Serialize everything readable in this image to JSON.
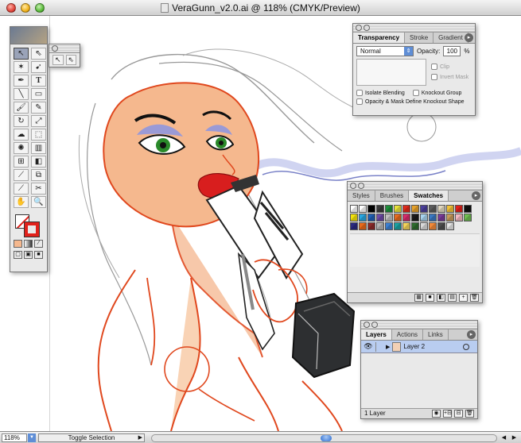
{
  "window": {
    "title": "VeraGunn_v2.0.ai @ 118% (CMYK/Preview)"
  },
  "transparency": {
    "tabs": [
      "Transparency",
      "Stroke",
      "Gradient"
    ],
    "blend_mode": "Normal",
    "opacity_label": "Opacity:",
    "opacity_value": "100",
    "opacity_unit": "%",
    "clip_label": "Clip",
    "invert_mask_label": "Invert Mask",
    "isolate_blending_label": "Isolate Blending",
    "knockout_group_label": "Knockout Group",
    "opacity_mask_label": "Opacity & Mask Define Knockout Shape"
  },
  "swatches": {
    "tabs": [
      "Styles",
      "Brushes",
      "Swatches"
    ],
    "colors": [
      "#ffffff",
      "#ffffff",
      "#000000",
      "#3a3a3a",
      "#1d8f3a",
      "#e8e23a",
      "#e02a1b",
      "#e6a12b",
      "#4b3f99",
      "#5b5b5b",
      "#e2d8c0",
      "#f2c237",
      "#e0211b",
      "#0f0f0f",
      "#f2e20d",
      "#2aa6e0",
      "#1f5fb5",
      "#6e4aa8",
      "#c0c0c0",
      "#e66b1e",
      "#d62a6b",
      "#1a1a1a",
      "#a8d3f0",
      "#3a78c2",
      "#7a3a9a",
      "#c89a5a",
      "#f5b8c0",
      "#6fbf50",
      "#2a2a80",
      "#e86a1c",
      "#8c2a2a",
      "#b5b5b5",
      "#3b7fd1",
      "#1ba0a0",
      "#f2d25a",
      "#2e6b2e",
      "#d9d9d9",
      "#f28a3a",
      "#4d4d4d",
      "#e6e6e6"
    ]
  },
  "layers": {
    "tabs": [
      "Layers",
      "Actions",
      "Links"
    ],
    "rows": [
      {
        "name": "Layer 2"
      }
    ],
    "count_label": "1 Layer"
  },
  "status": {
    "zoom": "118%",
    "mode": "Toggle Selection"
  },
  "icons": {
    "toolbox": [
      "selection-arrow-icon",
      "direct-selection-icon",
      "magic-wand-icon",
      "lasso-icon",
      "pen-icon",
      "type-icon",
      "line-icon",
      "rectangle-icon",
      "paintbrush-icon",
      "pencil-icon",
      "rotate-icon",
      "scale-icon",
      "warp-icon",
      "free-transform-icon",
      "symbol-sprayer-icon",
      "graph-icon",
      "mesh-icon",
      "gradient-icon",
      "eyedropper-icon",
      "blend-icon",
      "slice-icon",
      "scissors-icon",
      "hand-icon",
      "zoom-icon"
    ]
  },
  "colors": {
    "stroke_accent": "#e0211b",
    "highlight": "#b9cdf0",
    "skin": "#f5b88e"
  }
}
